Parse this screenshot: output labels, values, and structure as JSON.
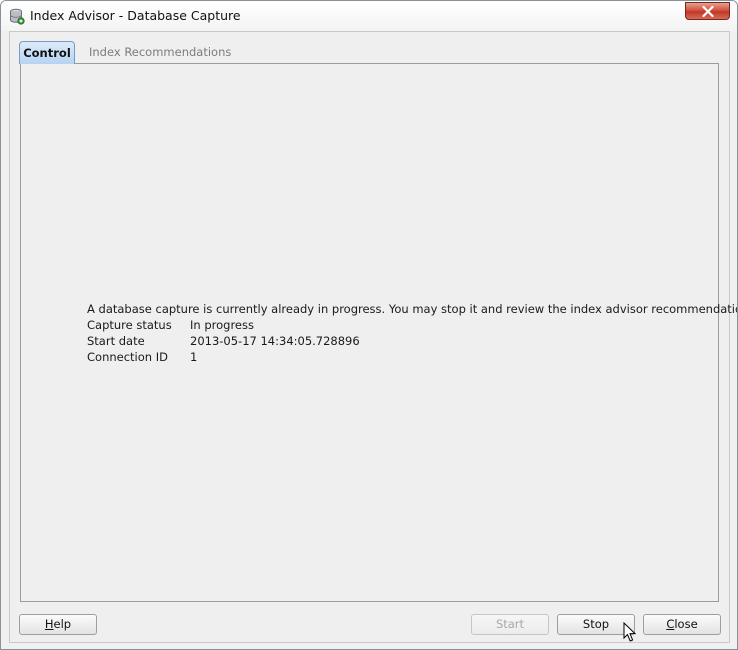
{
  "window": {
    "title": "Index Advisor - Database Capture",
    "icon": "database-icon",
    "close_icon": "close-icon"
  },
  "tabs": [
    {
      "label": "Control",
      "active": true
    },
    {
      "label": "Index Recommendations",
      "active": false
    }
  ],
  "control": {
    "message": "A database capture is currently already in progress.  You may stop it and review the index advisor recommendations.",
    "details": [
      {
        "label": "Capture status",
        "value": "In progress"
      },
      {
        "label": "Start date",
        "value": "2013-05-17 14:34:05.728896"
      },
      {
        "label": "Connection ID",
        "value": "1"
      }
    ]
  },
  "buttons": {
    "help": {
      "label_underlined": "H",
      "label_rest": "elp"
    },
    "start": {
      "label": "Start",
      "enabled": false
    },
    "stop": {
      "label": "Stop",
      "enabled": true
    },
    "close": {
      "label_underlined": "C",
      "label_rest": "lose"
    }
  },
  "colors": {
    "active_tab": "#b7d3f1",
    "close_button": "#c0382a",
    "window_background": "#f0f0f0"
  }
}
